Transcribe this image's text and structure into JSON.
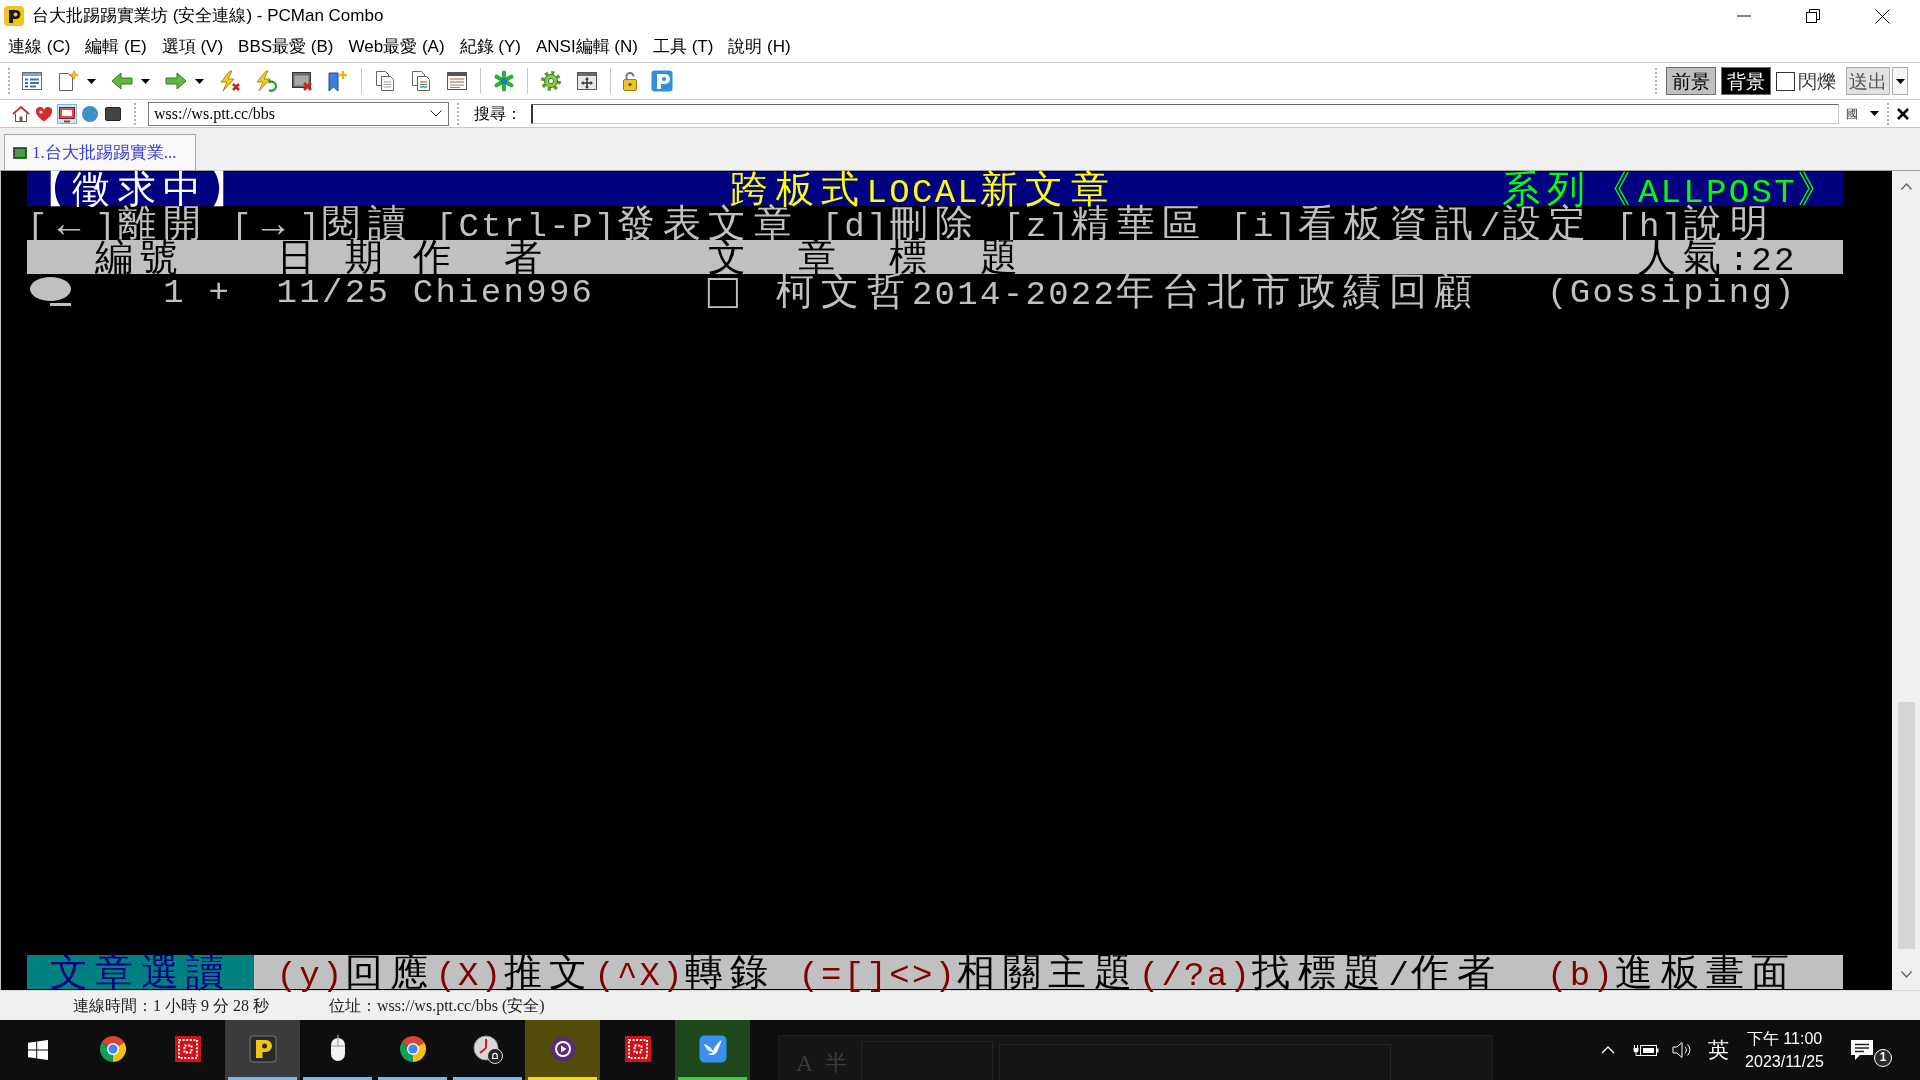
{
  "window": {
    "title": "台大批踢踢實業坊 (安全連線) - PCMan Combo"
  },
  "menu": [
    "連線 (C)",
    "編輯 (E)",
    "選項 (V)",
    "BBS最愛 (B)",
    "Web最愛 (A)",
    "紀錄 (Y)",
    "ANSI編輯 (N)",
    "工具 (T)",
    "說明 (H)"
  ],
  "toolbar": {
    "foreground": {
      "label": "前景",
      "color": "#c0c0c0"
    },
    "background": {
      "label": "背景",
      "color": "#000000"
    },
    "blink": {
      "label": "閃爍",
      "checked": false
    },
    "send": "送出"
  },
  "address_bar": {
    "view_buttons": [
      {
        "selected": false
      },
      {
        "selected": false
      },
      {
        "selected": true
      },
      {
        "selected": false
      },
      {
        "selected": false
      }
    ],
    "address": "wss://ws.ptt.cc/bbs",
    "search_label": "搜尋：",
    "ime_mode": "國"
  },
  "tabs": [
    {
      "label": "1.台大批踢踢實業...",
      "selected": true
    }
  ],
  "terminal": {
    "banner": {
      "status": "【徵求中】",
      "title": "跨板式LOCAL新文章",
      "series": "系列《ALLPOST》"
    },
    "help": [
      "[←]離開",
      "[→]閱讀",
      "[Ctrl-P]發表文章",
      "[d]刪除",
      "[z]精華區",
      "[i]看板資訊/設定",
      "[h]說明"
    ],
    "columns": [
      "編號",
      "日 期",
      "作  者",
      "文  章  標  題",
      "人氣:22"
    ],
    "posts": [
      {
        "selected": true,
        "number": "1",
        "read_mark": "+",
        "date": "11/25",
        "author": "Chien996",
        "post_type": "□",
        "title": "柯文哲2014-2022年台北市政績回顧",
        "board": "(Gossiping)"
      }
    ],
    "footer": {
      "mode": "文章選讀",
      "commands": [
        {
          "key": "(y)",
          "label": "回應"
        },
        {
          "key": "(X)",
          "label": "推文"
        },
        {
          "key": "(^X)",
          "label": "轉錄"
        },
        {
          "key": "(=[]<>)",
          "label": "相關主題"
        },
        {
          "key": "(/?a)",
          "label": "找標題/作者"
        },
        {
          "key": "(b)",
          "label": "進板畫面"
        }
      ]
    }
  },
  "status_bar": {
    "connection_time": "連線時間：1 小時 9 分 28 秒",
    "address": "位址：wss://ws.ptt.cc/bbs (安全)"
  },
  "taskbar": {
    "apps": [
      {
        "running": false,
        "selected": false,
        "highlighted": false
      },
      {
        "running": false,
        "selected": false,
        "highlighted": false
      },
      {
        "running": true,
        "selected": true,
        "highlighted": false,
        "color": "#76b9ed"
      },
      {
        "running": true,
        "selected": false,
        "highlighted": false,
        "color": "#76b9ed"
      },
      {
        "running": true,
        "selected": false,
        "highlighted": false,
        "color": "#76b9ed"
      },
      {
        "running": true,
        "selected": false,
        "highlighted": false,
        "color": "#76b9ed"
      },
      {
        "running": true,
        "selected": false,
        "highlighted": true,
        "color": "#f2e200"
      },
      {
        "running": false,
        "selected": false,
        "highlighted": false
      },
      {
        "running": true,
        "selected": false,
        "highlighted": true,
        "color": "#3dcf3d"
      }
    ],
    "ime_bar": [
      "A",
      "半"
    ],
    "tray": {
      "language": "英",
      "time": "下午 11:00",
      "date": "2023/11/25",
      "notifications": "1"
    }
  }
}
